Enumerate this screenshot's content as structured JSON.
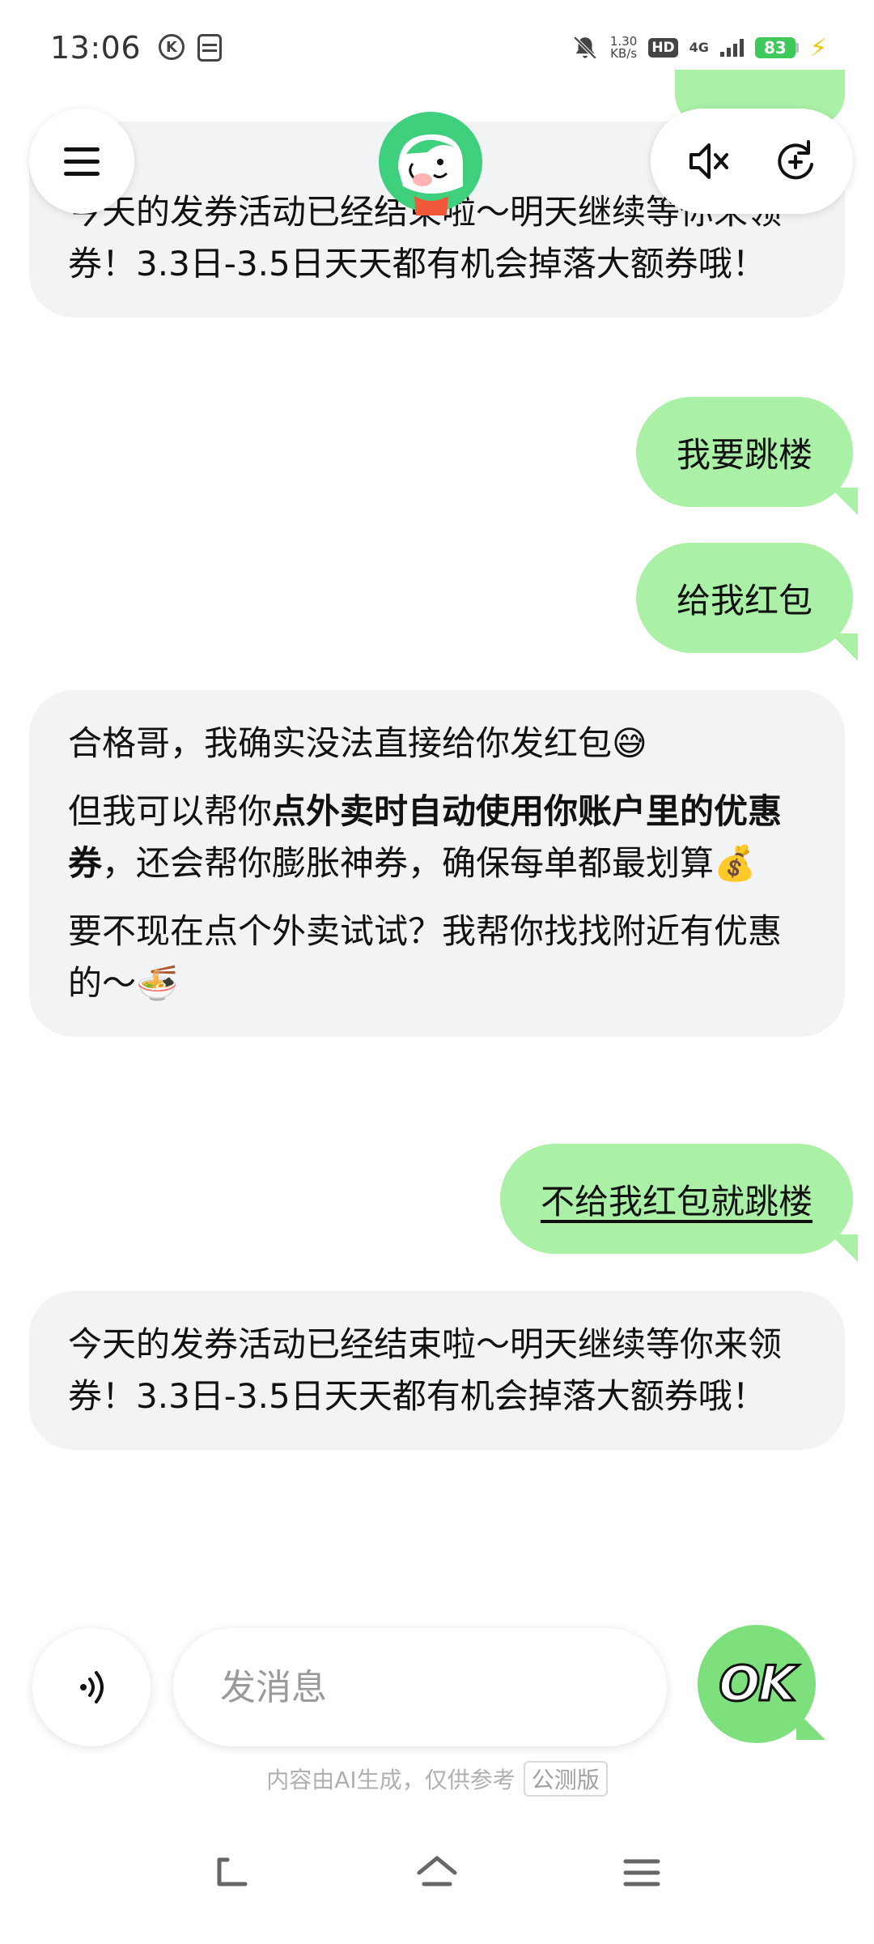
{
  "status_bar": {
    "time": "13:06",
    "speed_value": "1.30",
    "speed_unit": "KB/s",
    "hd": "HD",
    "network": "4G",
    "battery": "83"
  },
  "chat": {
    "messages": [
      {
        "role": "ai",
        "paragraphs": [
          "今天的发券活动已经结束啦～明天继续等你来领券！3.3日-3.5日天天都有机会掉落大额券哦！"
        ]
      },
      {
        "role": "user",
        "text": "我要跳楼"
      },
      {
        "role": "user",
        "text": "给我红包"
      },
      {
        "role": "ai",
        "p1": "合格哥，我确实没法直接给你发红包",
        "p1_emoji": "😅",
        "p2_prefix": "但我可以帮你",
        "p2_bold": "点外卖时自动使用你账户里的优惠券",
        "p2_suffix": "，还会帮你膨胀神券，确保每单都最划算",
        "p2_emoji": "💰",
        "p3": "要不现在点个外卖试试？我帮你找找附近有优惠的～",
        "p3_emoji": "🍜"
      },
      {
        "role": "user",
        "text": "不给我红包就跳楼"
      },
      {
        "role": "ai",
        "paragraphs": [
          "今天的发券活动已经结束啦～明天继续等你来领券！3.3日-3.5日天天都有机会掉落大额券哦！"
        ]
      }
    ]
  },
  "input": {
    "placeholder": "发消息",
    "ok_label": "OK"
  },
  "footer": {
    "disclaimer": "内容由AI生成，仅供参考",
    "beta": "公测版"
  },
  "icons": {
    "menu": "hamburger-menu-icon",
    "mute": "speaker-mute-icon",
    "new_chat": "refresh-plus-icon",
    "voice": "voice-wave-icon",
    "nav_back": "back-icon",
    "nav_home": "home-icon",
    "nav_recents": "recents-icon"
  },
  "colors": {
    "user_bubble": "#aaf0a6",
    "ai_bubble": "#f2f3f5",
    "ok_button": "#7ee07c",
    "battery": "#3ec95a"
  }
}
